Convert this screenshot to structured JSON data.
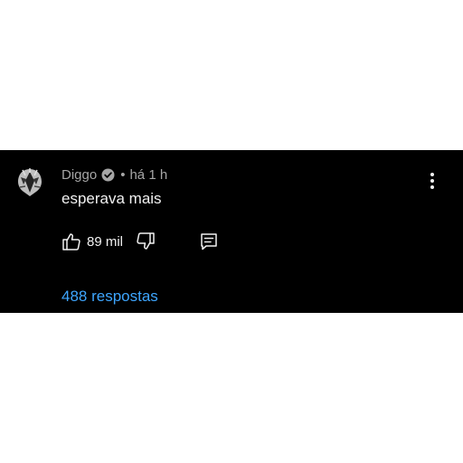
{
  "colors": {
    "card_background": "#000000",
    "page_background": "#ffffff",
    "text_primary": "#f1f1f1",
    "text_secondary": "#a6a6a6",
    "link": "#3ea6ff"
  },
  "comment": {
    "author": "Diggo",
    "verified": true,
    "separator": "•",
    "time": "há 1 h",
    "text": "esperava mais",
    "like_count": "89 mil",
    "replies_label": "488 respostas"
  },
  "icons": {
    "avatar": "avatar-image",
    "verified": "check-circle-icon",
    "menu": "more-vertical-icon",
    "like": "thumbs-up-icon",
    "dislike": "thumbs-down-icon",
    "reply": "comment-reply-icon"
  }
}
